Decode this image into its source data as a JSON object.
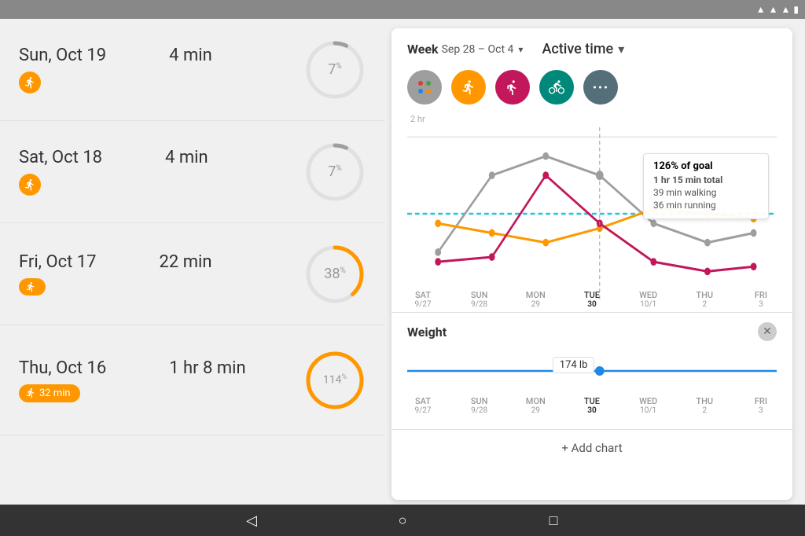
{
  "status_bar": {
    "bluetooth_icon": "bluetooth",
    "wifi_icon": "wifi",
    "signal_icon": "signal",
    "battery_icon": "battery"
  },
  "days": [
    {
      "date": "Sun, Oct 19",
      "duration": "4 min",
      "activity_icon": "🚶",
      "progress_value": 7,
      "progress_label": "7%",
      "has_pill": false,
      "extra_text": ""
    },
    {
      "date": "Sat, Oct 18",
      "duration": "4 min",
      "activity_icon": "🚶",
      "progress_value": 7,
      "progress_label": "7%",
      "has_pill": false,
      "extra_text": ""
    },
    {
      "date": "Fri, Oct 17",
      "duration": "22 min",
      "activity_icon": "🚶",
      "progress_value": 38,
      "progress_label": "38%",
      "has_pill": true,
      "extra_text": ""
    },
    {
      "date": "Thu, Oct 16",
      "duration": "1 hr 8 min",
      "activity_icon": "🚶",
      "progress_value": 114,
      "progress_label": "114%",
      "has_pill": true,
      "extra_text": "32 min"
    }
  ],
  "chart": {
    "week_label": "Week",
    "week_range": "Sep 28 – Oct 4",
    "title": "Active time",
    "y_label": "2 hr",
    "x_labels": [
      {
        "day": "SAT",
        "date": "9/27"
      },
      {
        "day": "SUN",
        "date": "9/28"
      },
      {
        "day": "MON",
        "date": "29"
      },
      {
        "day": "TUE",
        "date": "30"
      },
      {
        "day": "WED",
        "date": "10/1"
      },
      {
        "day": "THU",
        "date": "2"
      },
      {
        "day": "FRI",
        "date": "3"
      }
    ],
    "tooltip": {
      "goal_text": "126% of goal",
      "total_text": "1 hr 15 min total",
      "walking_text": "39 min walking",
      "running_text": "36 min running"
    }
  },
  "activity_types": [
    {
      "label": "all",
      "color": "#9E9E9E",
      "icon": "⬤"
    },
    {
      "label": "walking",
      "color": "#FF9800",
      "icon": "🚶"
    },
    {
      "label": "running",
      "color": "#C2185B",
      "icon": "🏃"
    },
    {
      "label": "cycling",
      "color": "#00897B",
      "icon": "🚴"
    },
    {
      "label": "more",
      "color": "#546E7A",
      "icon": "•••"
    }
  ],
  "weight": {
    "title": "Weight",
    "value": "174 lb",
    "x_labels": [
      {
        "day": "SAT",
        "date": "9/27"
      },
      {
        "day": "SUN",
        "date": "9/28"
      },
      {
        "day": "MON",
        "date": "29"
      },
      {
        "day": "TUE",
        "date": "30"
      },
      {
        "day": "WED",
        "date": "10/1"
      },
      {
        "day": "THU",
        "date": "2"
      },
      {
        "day": "FRI",
        "date": "3"
      }
    ]
  },
  "add_chart": {
    "label": "+ Add chart"
  },
  "nav": {
    "back_icon": "◁",
    "home_icon": "○",
    "recent_icon": "□"
  }
}
